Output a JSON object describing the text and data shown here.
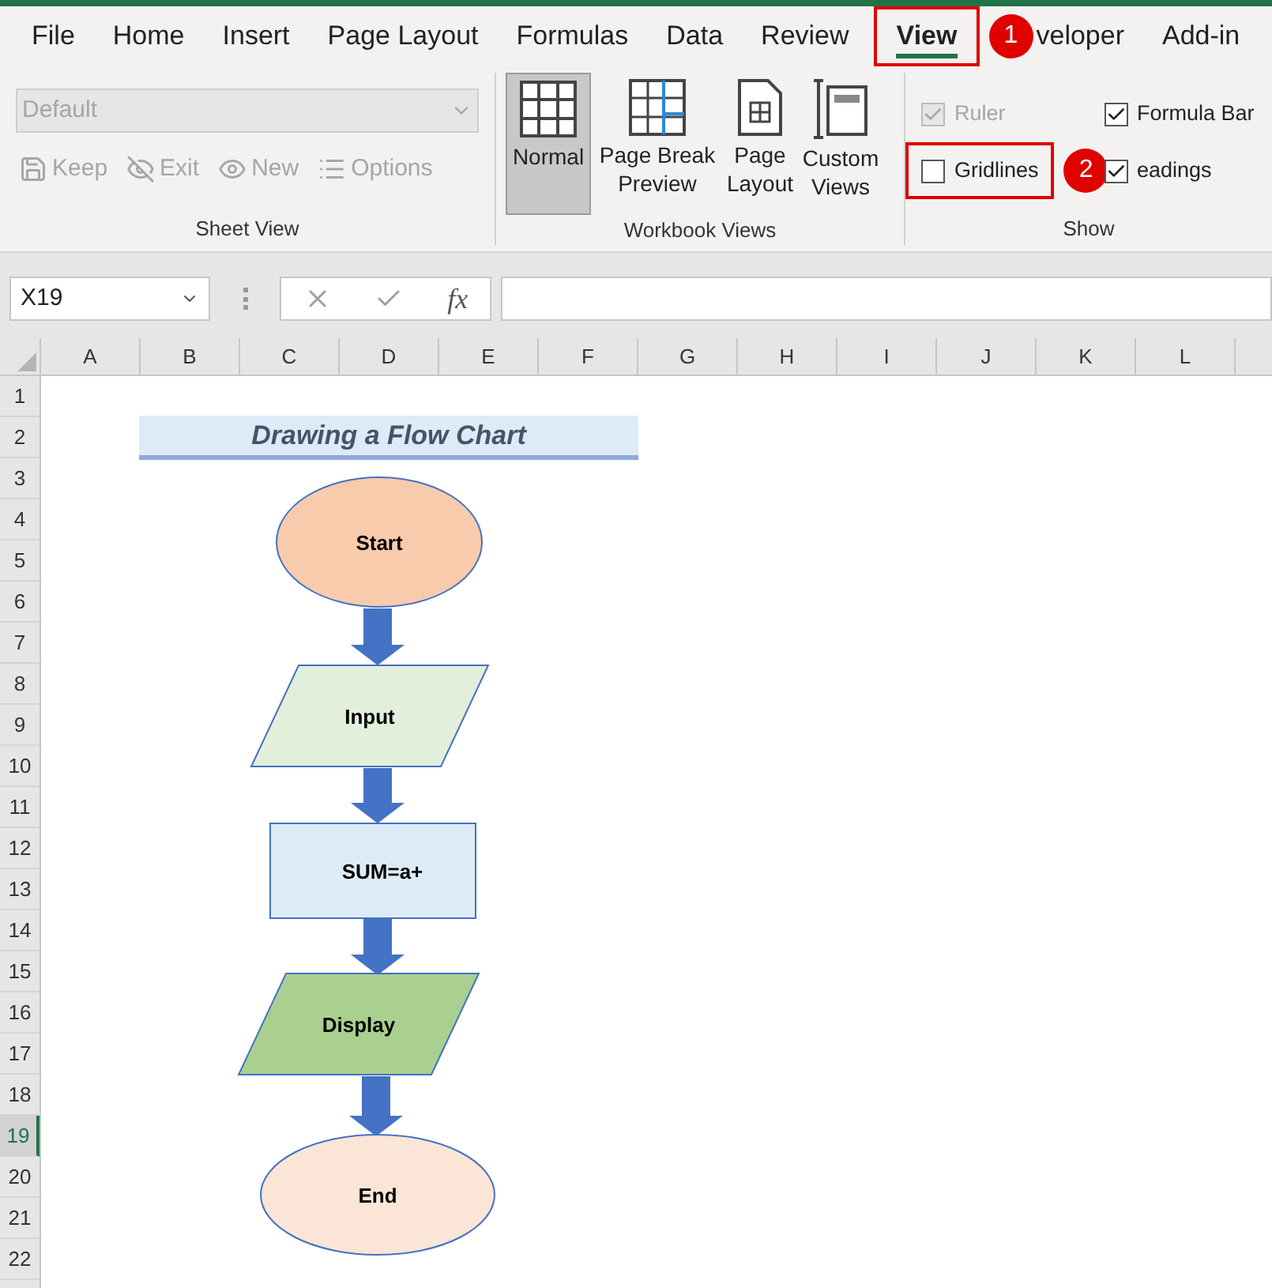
{
  "ribbon_tabs": [
    {
      "label": "File",
      "selected": false
    },
    {
      "label": "Home",
      "selected": false
    },
    {
      "label": "Insert",
      "selected": false
    },
    {
      "label": "Page Layout",
      "selected": false
    },
    {
      "label": "Formulas",
      "selected": false
    },
    {
      "label": "Data",
      "selected": false
    },
    {
      "label": "Review",
      "selected": false
    },
    {
      "label": "View",
      "selected": true,
      "callout": "1"
    },
    {
      "label": "veloper",
      "selected": false
    },
    {
      "label": "Add-in",
      "selected": false
    }
  ],
  "sheet_view": {
    "label": "Sheet View",
    "dropdown": {
      "value": "Default",
      "disabled": true
    },
    "buttons": [
      {
        "kind": "keep",
        "label": "Keep",
        "disabled": true
      },
      {
        "kind": "exit",
        "label": "Exit",
        "disabled": true
      },
      {
        "kind": "new",
        "label": "New",
        "disabled": true
      },
      {
        "kind": "options",
        "label": "Options",
        "disabled": true
      }
    ]
  },
  "workbook_views": {
    "label": "Workbook Views",
    "items": [
      {
        "kind": "normal",
        "label": "Normal",
        "selected": true
      },
      {
        "kind": "page_break",
        "label": "Page Break Preview",
        "selected": false
      },
      {
        "kind": "page_layout",
        "label": "Page Layout",
        "selected": false
      },
      {
        "kind": "custom",
        "label": "Custom Views",
        "selected": false
      }
    ]
  },
  "show": {
    "label": "Show",
    "checkboxes": [
      {
        "label": "Ruler",
        "checked": true,
        "disabled": true
      },
      {
        "label": "Formula Bar",
        "checked": true,
        "disabled": false
      },
      {
        "label": "Gridlines",
        "checked": false,
        "disabled": false,
        "callout": "2"
      },
      {
        "label": "eadings",
        "checked": true,
        "disabled": false
      }
    ]
  },
  "formula_bar": {
    "name_box": "X19",
    "function_symbol": "fx"
  },
  "columns": [
    "A",
    "B",
    "C",
    "D",
    "E",
    "F",
    "G",
    "H",
    "I",
    "J",
    "K",
    "L"
  ],
  "rows": [
    {
      "label": "1",
      "selected": false
    },
    {
      "label": "2",
      "selected": false
    },
    {
      "label": "3",
      "selected": false
    },
    {
      "label": "4",
      "selected": false
    },
    {
      "label": "5",
      "selected": false
    },
    {
      "label": "6",
      "selected": false
    },
    {
      "label": "7",
      "selected": false
    },
    {
      "label": "8",
      "selected": false
    },
    {
      "label": "9",
      "selected": false
    },
    {
      "label": "10",
      "selected": false
    },
    {
      "label": "11",
      "selected": false
    },
    {
      "label": "12",
      "selected": false
    },
    {
      "label": "13",
      "selected": false
    },
    {
      "label": "14",
      "selected": false
    },
    {
      "label": "15",
      "selected": false
    },
    {
      "label": "16",
      "selected": false
    },
    {
      "label": "17",
      "selected": false
    },
    {
      "label": "18",
      "selected": false
    },
    {
      "label": "19",
      "selected": true
    },
    {
      "label": "20",
      "selected": false
    },
    {
      "label": "21",
      "selected": false
    },
    {
      "label": "22",
      "selected": false
    }
  ],
  "flowchart": {
    "title": "Drawing a Flow Chart",
    "nodes": [
      {
        "kind": "terminal",
        "label": "Start",
        "color": "#f8cbad"
      },
      {
        "kind": "io",
        "label": "Input",
        "color": "#e2efda"
      },
      {
        "kind": "process",
        "label": "SUM=a+",
        "color": "#ddebf7"
      },
      {
        "kind": "io",
        "label": "Display",
        "color": "#a9d08e"
      },
      {
        "kind": "terminal",
        "label": "End",
        "color": "#fbe5d6"
      }
    ]
  }
}
